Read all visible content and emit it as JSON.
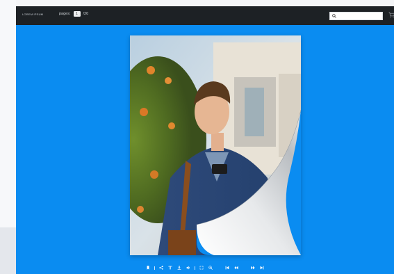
{
  "header": {
    "brand": "LOREM IPSUM",
    "pages_label": "pages:",
    "current_page": "1",
    "total_pages": "/20",
    "search_placeholder": ""
  },
  "toolbar": {
    "buttons": [
      {
        "icon": "bookmark-icon"
      },
      {
        "icon": "separator"
      },
      {
        "icon": "share-icon"
      },
      {
        "icon": "text-icon"
      },
      {
        "icon": "download-icon"
      },
      {
        "icon": "sound-icon"
      },
      {
        "icon": "separator"
      },
      {
        "icon": "fullscreen-icon"
      },
      {
        "icon": "zoom-in-icon"
      },
      {
        "icon": "first-page-icon"
      },
      {
        "icon": "previous-page-icon"
      },
      {
        "icon": "next-page-icon"
      },
      {
        "icon": "last-page-icon"
      }
    ]
  },
  "colors": {
    "viewer_background": "#0a8cf1",
    "topbar": "#1d2125",
    "icon": "#ffffff"
  }
}
